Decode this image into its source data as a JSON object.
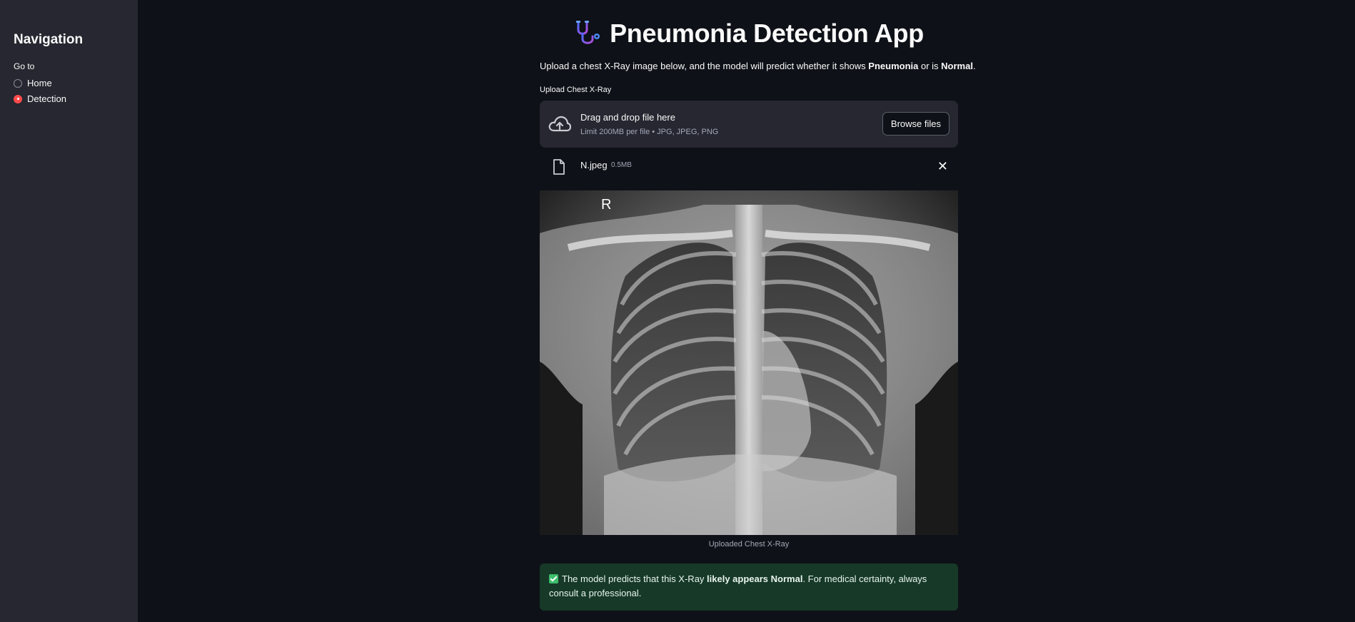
{
  "sidebar": {
    "title": "Navigation",
    "goto_label": "Go to",
    "options": [
      {
        "label": "Home",
        "selected": false
      },
      {
        "label": "Detection",
        "selected": true
      }
    ]
  },
  "header": {
    "icon": "stethoscope-icon",
    "title": "Pneumonia Detection App"
  },
  "intro": {
    "prefix": "Upload a chest X-Ray image below, and the model will predict whether it shows ",
    "pneumonia": "Pneumonia",
    "middle": " or is ",
    "normal": "Normal",
    "suffix": "."
  },
  "uploader": {
    "label": "Upload Chest X-Ray",
    "drop_text": "Drag and drop file here",
    "limit_text": "Limit 200MB per file • JPG, JPEG, PNG",
    "browse_label": "Browse files",
    "icon": "cloud-upload-icon"
  },
  "file": {
    "name": "N.jpeg",
    "size": "0.5MB",
    "icon": "file-icon",
    "remove_icon": "close-icon"
  },
  "image": {
    "marker": "R",
    "caption": "Uploaded Chest X-Ray"
  },
  "result": {
    "prefix": "The model predicts that this X-Ray ",
    "emphasis": "likely appears Normal",
    "suffix": ". For medical certainty, always consult a professional.",
    "status_color": "#173928"
  },
  "colors": {
    "accent": "#ff4b4b",
    "background": "#0e1117",
    "sidebar": "#262730"
  }
}
